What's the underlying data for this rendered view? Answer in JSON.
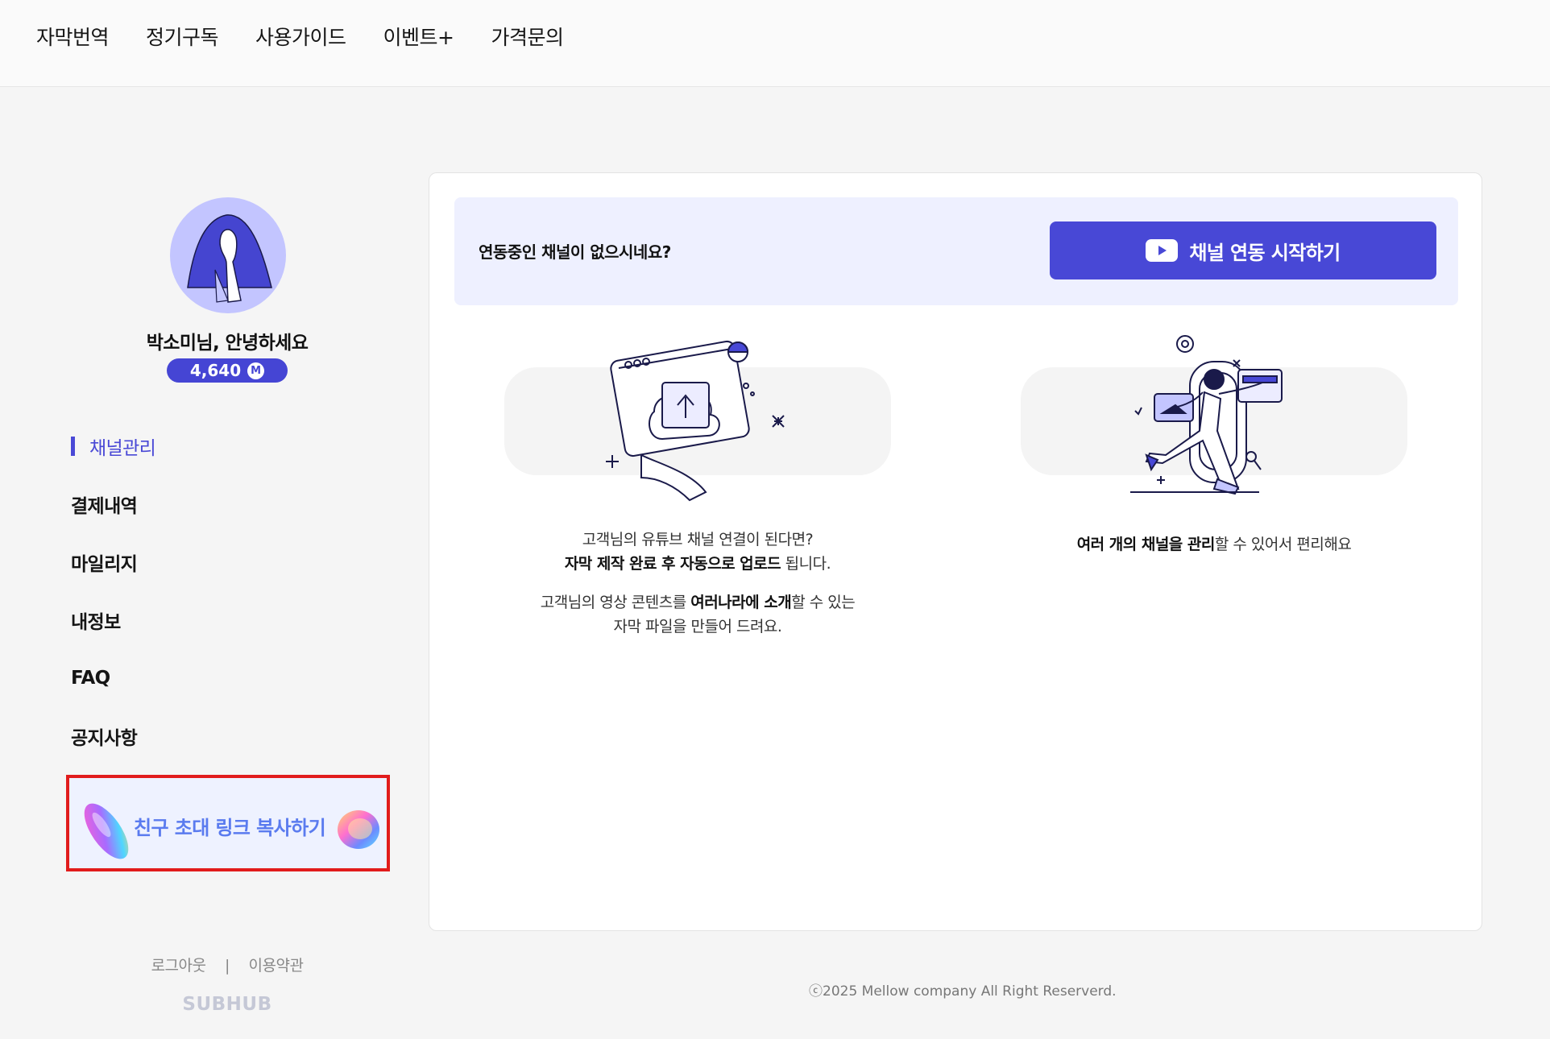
{
  "topnav": {
    "items": [
      "자막번역",
      "정기구독",
      "사용가이드",
      "이벤트+",
      "가격문의"
    ]
  },
  "sidebar": {
    "greeting": "박소미님, 안녕하세요",
    "points": "4,640",
    "points_unit": "M",
    "menu": [
      "채널관리",
      "결제내역",
      "마일리지",
      "내정보",
      "FAQ",
      "공지사항"
    ],
    "active_menu": "채널관리",
    "invite_label": "친구 초대 링크 복사하기",
    "footer": {
      "logout": "로그아웃",
      "separator": "|",
      "terms": "이용약관",
      "logo": "SUBHUB"
    }
  },
  "main": {
    "banner_text": "연동중인 채널이 없으시네요?",
    "connect_button": "채널 연동 시작하기",
    "feature1": {
      "line1": "고객님의 유튜브 채널 연결이 된다면?",
      "line2_bold": "자막 제작 완료 후 자동으로 업로드",
      "line2_rest": " 됩니다.",
      "line3_pre": "고객님의 영상 콘텐츠를 ",
      "line3_bold": "여러나라에 소개",
      "line3_post": "할 수 있는",
      "line4": "자막 파일을 만들어 드려요."
    },
    "feature2": {
      "bold": "여러 개의 채널을 관리",
      "rest": "할 수 있어서 편리해요"
    }
  },
  "copyright": "ⓒ2025 Mellow company All Right Reserverd.",
  "colors": {
    "accent": "#4848d6",
    "invite_text": "#5a7bef",
    "highlight_border": "#e11c1c",
    "avatar_bg": "#c3c5ff"
  }
}
